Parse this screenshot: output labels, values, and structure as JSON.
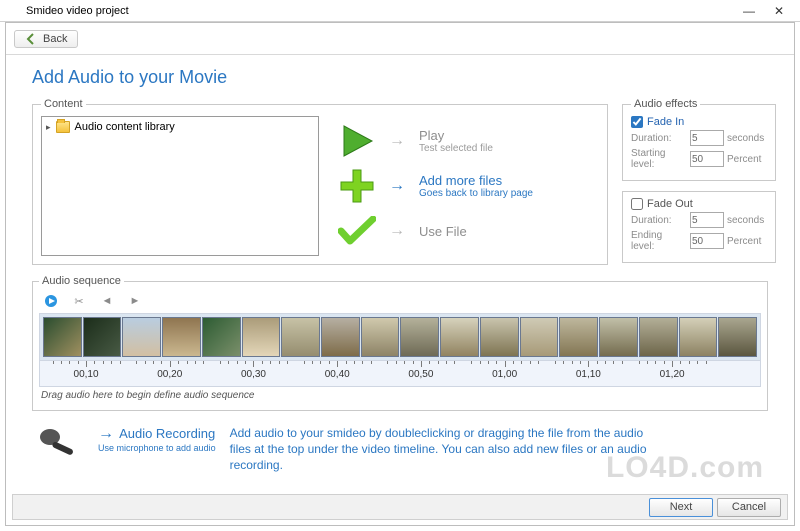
{
  "window": {
    "title": "Smideo video project"
  },
  "toolbar": {
    "back": "Back"
  },
  "page": {
    "title": "Add Audio to your Movie"
  },
  "contentBox": {
    "legend": "Content",
    "library_item": "Audio content library"
  },
  "actions": {
    "play": {
      "title": "Play",
      "sub": "Test selected file"
    },
    "add": {
      "title": "Add more files",
      "sub": "Goes back to library page"
    },
    "use": {
      "title": "Use File",
      "sub": ""
    }
  },
  "effects": {
    "legend": "Audio effects",
    "fadein": {
      "label": "Fade In",
      "checked": true,
      "duration_label": "Duration:",
      "duration": 5,
      "duration_unit": "seconds",
      "level_label": "Starting level:",
      "level": 50,
      "level_unit": "Percent"
    },
    "fadeout": {
      "label": "Fade Out",
      "checked": false,
      "duration_label": "Duration:",
      "duration": 5,
      "duration_unit": "seconds",
      "level_label": "Ending level:",
      "level": 50,
      "level_unit": "Percent"
    }
  },
  "sequence": {
    "legend": "Audio sequence",
    "ticks": [
      "00,10",
      "00,20",
      "00,30",
      "00,40",
      "00,50",
      "01,00",
      "01,10",
      "01,20"
    ],
    "drop_hint": "Drag audio here to begin define audio sequence"
  },
  "recording": {
    "title": "Audio Recording",
    "sub": "Use microphone to add audio",
    "desc": "Add audio to your smideo by doubleclicking or dragging the file from the audio files at the top under the video timeline. You can also add new files or an audio recording."
  },
  "footer": {
    "next": "Next",
    "cancel": "Cancel"
  },
  "watermark": "LO4D.com"
}
